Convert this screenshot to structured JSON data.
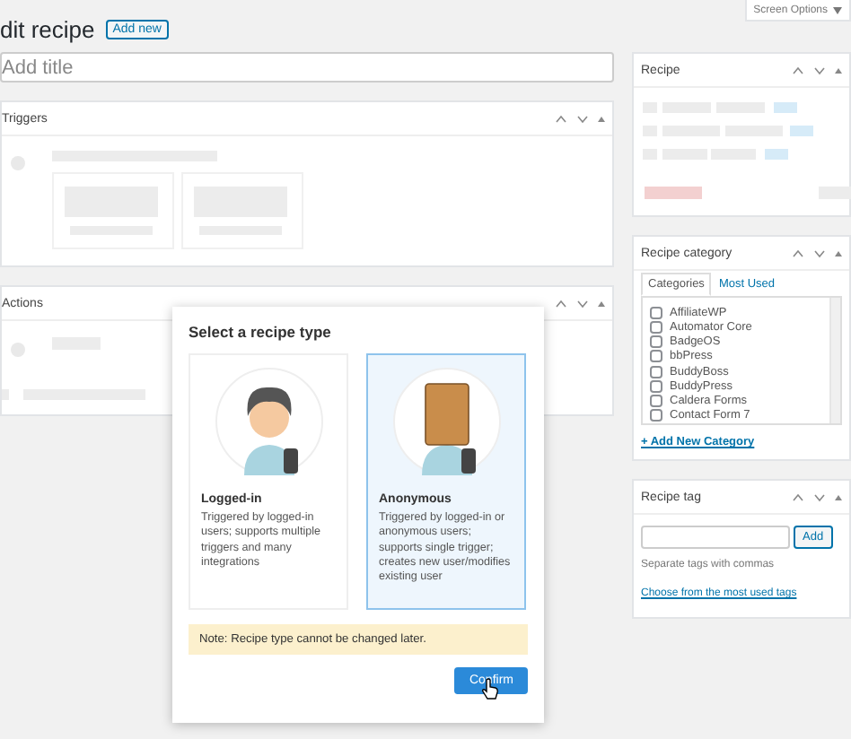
{
  "screen_options": {
    "label": "Screen Options"
  },
  "heading": {
    "title": "dit recipe",
    "add_new": "Add new"
  },
  "title_field": {
    "placeholder": "Add title"
  },
  "panels": [
    {
      "kind": "triggers",
      "title": "Triggers"
    },
    {
      "kind": "actions",
      "title": "Actions"
    }
  ],
  "sidebar": {
    "recipe": {
      "title": "Recipe"
    },
    "category": {
      "title": "Recipe category",
      "tabs": [
        {
          "label": "Categories",
          "selected": true
        },
        {
          "label": "Most Used",
          "selected": false
        }
      ],
      "items": [
        {
          "label": "AffiliateWP",
          "checked": false
        },
        {
          "label": "Automator Core",
          "checked": false
        },
        {
          "label": "BadgeOS",
          "checked": false
        },
        {
          "label": "bbPress",
          "checked": false
        },
        {
          "label": "BuddyBoss",
          "checked": false
        },
        {
          "label": "BuddyPress",
          "checked": false
        },
        {
          "label": "Caldera Forms",
          "checked": false
        },
        {
          "label": "Contact Form 7",
          "checked": false
        }
      ],
      "add_link": "+ Add New Category"
    },
    "tag": {
      "title": "Recipe tag",
      "add_button": "Add",
      "hint": "Separate tags with commas",
      "link": "Choose from the most used tags"
    }
  },
  "modal": {
    "title": "Select a recipe type",
    "options": [
      {
        "kind": "logged-in",
        "title": "Logged-in",
        "description": "Triggered by logged-in users; supports multiple triggers and many integrations",
        "selected": false
      },
      {
        "kind": "anonymous",
        "title": "Anonymous",
        "description": "Triggered by logged-in or anonymous users; supports single trigger; creates new user/modifies existing user",
        "selected": true
      }
    ],
    "note": "Note: Recipe type cannot be changed later.",
    "confirm": "Confirm"
  }
}
